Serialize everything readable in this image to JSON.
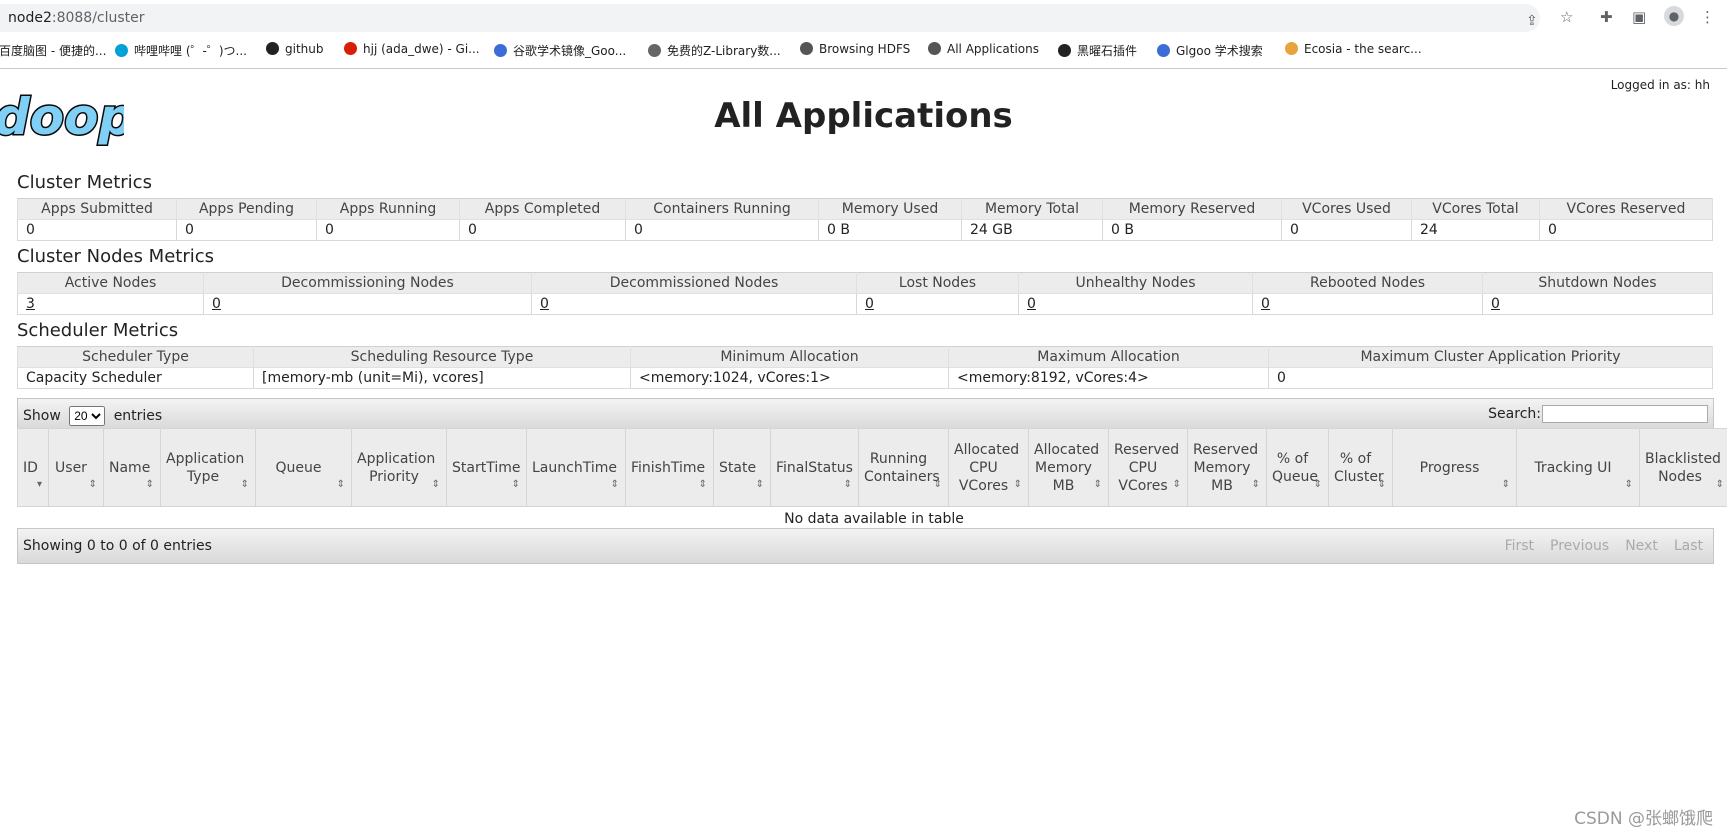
{
  "browser": {
    "url_host": "node2",
    "url_rest": ":8088/cluster",
    "bookmarks": [
      {
        "label": "百度脑图 - 便捷的...",
        "color": "#2f6fd1"
      },
      {
        "label": "哔哩哔哩 (゜-゜)つ...",
        "color": "#00a1d6"
      },
      {
        "label": "github",
        "color": "#222222"
      },
      {
        "label": "hjj (ada_dwe) - Gi...",
        "color": "#d81e06"
      },
      {
        "label": "谷歌学术镜像_Goo...",
        "color": "#3b6cd8"
      },
      {
        "label": "免费的Z-Library数...",
        "color": "#666666"
      },
      {
        "label": "Browsing HDFS",
        "color": "#555555"
      },
      {
        "label": "All Applications",
        "color": "#555555"
      },
      {
        "label": "黑曜石插件",
        "color": "#222222"
      },
      {
        "label": "Glgoo 学术搜索",
        "color": "#3b6cd8"
      },
      {
        "label": "Ecosia - the searc...",
        "color": "#e8a33d"
      }
    ]
  },
  "header": {
    "logged_in": "Logged in as: hh",
    "logo_text": "doop",
    "title": "All Applications"
  },
  "cluster_metrics": {
    "title": "Cluster Metrics",
    "headers": [
      "Apps Submitted",
      "Apps Pending",
      "Apps Running",
      "Apps Completed",
      "Containers Running",
      "Memory Used",
      "Memory Total",
      "Memory Reserved",
      "VCores Used",
      "VCores Total",
      "VCores Reserved"
    ],
    "values": [
      "0",
      "0",
      "0",
      "0",
      "0",
      "0 B",
      "24 GB",
      "0 B",
      "0",
      "24",
      "0"
    ]
  },
  "node_metrics": {
    "title": "Cluster Nodes Metrics",
    "headers": [
      "Active Nodes",
      "Decommissioning Nodes",
      "Decommissioned Nodes",
      "Lost Nodes",
      "Unhealthy Nodes",
      "Rebooted Nodes",
      "Shutdown Nodes"
    ],
    "values": [
      "3",
      "0",
      "0",
      "0",
      "0",
      "0",
      "0"
    ]
  },
  "scheduler_metrics": {
    "title": "Scheduler Metrics",
    "headers": [
      "Scheduler Type",
      "Scheduling Resource Type",
      "Minimum Allocation",
      "Maximum Allocation",
      "Maximum Cluster Application Priority"
    ],
    "values": [
      "Capacity Scheduler",
      "[memory-mb (unit=Mi), vcores]",
      "<memory:1024, vCores:1>",
      "<memory:8192, vCores:4>",
      "0"
    ]
  },
  "apps_table": {
    "show_label": "Show",
    "entries_label": "entries",
    "page_size": "20",
    "search_label": "Search:",
    "columns": [
      "ID",
      "User",
      "Name",
      "Application Type",
      "Queue",
      "Application Priority",
      "StartTime",
      "LaunchTime",
      "FinishTime",
      "State",
      "FinalStatus",
      "Running Containers",
      "Allocated CPU VCores",
      "Allocated Memory MB",
      "Reserved CPU VCores",
      "Reserved Memory MB",
      "% of Queue",
      "% of Cluster",
      "Progress",
      "Tracking UI",
      "Blacklisted Nodes"
    ],
    "empty_message": "No data available in table",
    "info": "Showing 0 to 0 of 0 entries",
    "pagination": [
      "First",
      "Previous",
      "Next",
      "Last"
    ]
  },
  "watermark": "CSDN @张螂饿爬"
}
